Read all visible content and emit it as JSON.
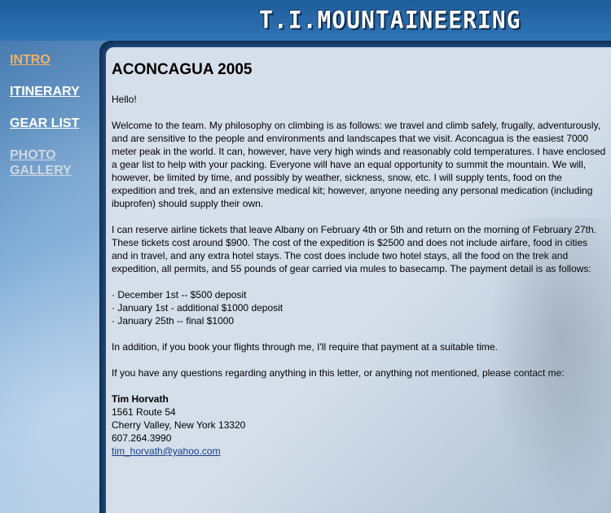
{
  "header": {
    "logo_text": "T.I.MOUNTAINEERING"
  },
  "nav": {
    "items": [
      {
        "label": "INTRO"
      },
      {
        "label": "ITINERARY"
      },
      {
        "label": "GEAR LIST"
      },
      {
        "label": "PHOTO GALLERY"
      }
    ]
  },
  "content": {
    "title": "ACONCAGUA 2005",
    "greeting": "Hello!",
    "para1": "Welcome to the team. My philosophy on climbing is as follows: we travel and climb safely, frugally, adventurously, and are sensitive to the people and environments and landscapes that we visit. Aconcagua is the easiest 7000 meter peak in the world. It can, however, have very high winds and reasonably cold temperatures. I have enclosed a gear list to help with your packing. Everyone will have an equal opportunity to summit the mountain. We will, however, be limited by time, and possibly by weather, sickness, snow, etc. I will supply tents, food on the expedition and trek, and an extensive medical kit; however, anyone needing any personal medication (including ibuprofen) should supply their own.",
    "para2": "I can reserve airline tickets that leave Albany on February 4th or 5th and return on the morning of February 27th. These tickets cost around $900. The cost of the expedition is $2500 and does not include airfare, food in cities and in travel, and any extra hotel stays. The cost does include two hotel stays, all the food on the trek and expedition, all permits, and 55 pounds of gear carried via mules to basecamp. The payment detail is as follows:",
    "payments": [
      "· December 1st -- $500 deposit",
      "· January 1st - additional $1000 deposit",
      "· January 25th -- final $1000"
    ],
    "para3": "In addition, if you book your flights through me, I'll require that payment at a suitable time.",
    "para4": "If you have any questions regarding anything in this letter, or anything not mentioned, please contact me:",
    "contact": {
      "name": "Tim Horvath",
      "address1": "1561 Route 54",
      "address2": "Cherry Valley, New York 13320",
      "phone": "607.264.3990",
      "email": "tim_horvath@yahoo.com"
    }
  }
}
